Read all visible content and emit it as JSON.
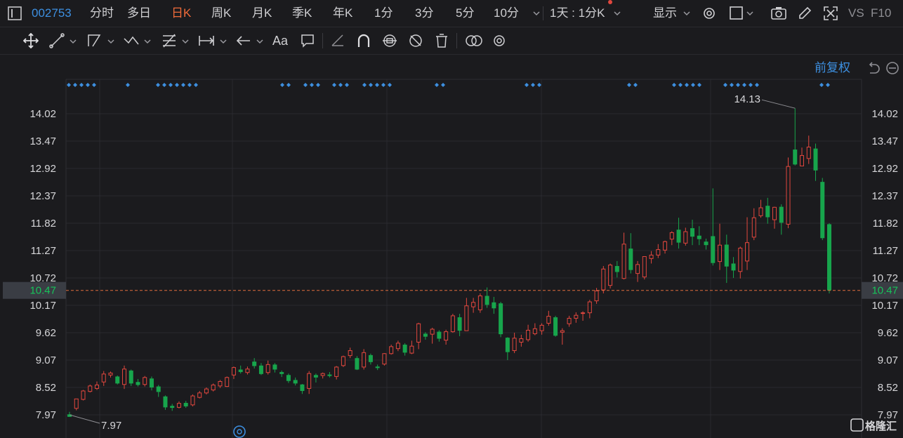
{
  "header": {
    "panel_icon": "panel-icon",
    "stock_code": "002753",
    "periods": [
      "分时",
      "多日",
      "日K",
      "周K",
      "月K",
      "季K",
      "年K",
      "1分",
      "3分",
      "5分",
      "10分"
    ],
    "active_period": "日K",
    "interval_select": "1天 : 1分K",
    "display_label": "显示",
    "vs_label": "VS",
    "f10_label": "F10"
  },
  "drawing_tools": [
    "move-tool",
    "line-tool",
    "polyline-tool",
    "wave-tool",
    "fib-tool",
    "range-tool",
    "arrow-tool",
    "text-tool",
    "note-tool",
    "eraser-tool",
    "magnet-tool",
    "sync-tool",
    "hide-tool",
    "delete-tool",
    "compare-tool",
    "settings-tool"
  ],
  "text_tool_label": "Aa",
  "chart_options": {
    "adjust_label": "前复权"
  },
  "colors": {
    "up": "#e2473e",
    "down": "#17a54c",
    "accent": "#3d8fe0",
    "active_tab": "#f06b3a",
    "current_line": "#e06c3c",
    "current_label_bg": "#3a3d44",
    "current_label_text": "#17c35a"
  },
  "chart_data": {
    "type": "candlestick",
    "y_ticks": [
      "14.02",
      "13.47",
      "12.92",
      "12.37",
      "11.82",
      "11.27",
      "10.72",
      "10.17",
      "9.62",
      "9.07",
      "8.52",
      "7.97"
    ],
    "ylim": [
      7.97,
      14.02
    ],
    "current_price": "10.47",
    "max_label": "14.13",
    "min_label": "7.97",
    "watermark": "格隆汇",
    "candles": [
      [
        7.98,
        7.93,
        8.03,
        7.93
      ],
      [
        8.1,
        8.29,
        8.29,
        8.06
      ],
      [
        8.28,
        8.45,
        8.47,
        8.26
      ],
      [
        8.44,
        8.55,
        8.58,
        8.42
      ],
      [
        8.5,
        8.57,
        8.64,
        8.47
      ],
      [
        8.63,
        8.79,
        8.85,
        8.55
      ],
      [
        8.77,
        8.81,
        8.84,
        8.72
      ],
      [
        8.74,
        8.6,
        8.76,
        8.58
      ],
      [
        8.58,
        8.89,
        8.96,
        8.49
      ],
      [
        8.86,
        8.6,
        8.88,
        8.55
      ],
      [
        8.63,
        8.57,
        8.69,
        8.54
      ],
      [
        8.58,
        8.72,
        8.75,
        8.54
      ],
      [
        8.7,
        8.52,
        8.74,
        8.46
      ],
      [
        8.54,
        8.43,
        8.57,
        8.33
      ],
      [
        8.34,
        8.12,
        8.36,
        8.07
      ],
      [
        8.15,
        8.11,
        8.19,
        8.05
      ],
      [
        8.12,
        8.2,
        8.24,
        8.1
      ],
      [
        8.21,
        8.14,
        8.25,
        8.11
      ],
      [
        8.17,
        8.35,
        8.38,
        8.14
      ],
      [
        8.32,
        8.41,
        8.45,
        8.3
      ],
      [
        8.41,
        8.49,
        8.52,
        8.38
      ],
      [
        8.47,
        8.57,
        8.6,
        8.44
      ],
      [
        8.55,
        8.64,
        8.67,
        8.51
      ],
      [
        8.54,
        8.72,
        8.74,
        8.53
      ],
      [
        8.77,
        8.92,
        8.94,
        8.69
      ],
      [
        8.88,
        8.83,
        8.96,
        8.8
      ],
      [
        8.82,
        8.89,
        8.94,
        8.78
      ],
      [
        9.04,
        8.95,
        9.11,
        8.9
      ],
      [
        8.96,
        8.79,
        9.01,
        8.77
      ],
      [
        8.82,
        8.98,
        9.06,
        8.78
      ],
      [
        8.98,
        8.88,
        9.01,
        8.82
      ],
      [
        8.83,
        8.79,
        8.86,
        8.73
      ],
      [
        8.77,
        8.65,
        8.8,
        8.61
      ],
      [
        8.67,
        8.6,
        8.72,
        8.56
      ],
      [
        8.58,
        8.45,
        8.59,
        8.39
      ],
      [
        8.5,
        8.8,
        8.85,
        8.39
      ],
      [
        8.77,
        8.72,
        8.8,
        8.62
      ],
      [
        8.76,
        8.8,
        8.82,
        8.7
      ],
      [
        8.78,
        8.75,
        8.83,
        8.72
      ],
      [
        8.74,
        8.93,
        8.95,
        8.68
      ],
      [
        8.96,
        9.14,
        9.16,
        8.93
      ],
      [
        9.16,
        9.26,
        9.32,
        9.11
      ],
      [
        9.11,
        8.88,
        9.15,
        8.87
      ],
      [
        8.93,
        9.22,
        9.29,
        8.88
      ],
      [
        9.17,
        9.03,
        9.2,
        8.98
      ],
      [
        8.94,
        8.91,
        8.98,
        8.87
      ],
      [
        8.99,
        9.2,
        9.21,
        8.96
      ],
      [
        9.2,
        9.34,
        9.38,
        9.18
      ],
      [
        9.3,
        9.41,
        9.46,
        9.25
      ],
      [
        9.38,
        9.22,
        9.41,
        9.16
      ],
      [
        9.21,
        9.35,
        9.46,
        9.19
      ],
      [
        9.43,
        9.8,
        9.82,
        9.29
      ],
      [
        9.6,
        9.54,
        9.63,
        9.48
      ],
      [
        9.59,
        9.69,
        9.72,
        9.4
      ],
      [
        9.64,
        9.5,
        9.67,
        9.44
      ],
      [
        9.47,
        9.64,
        9.68,
        9.38
      ],
      [
        9.64,
        9.96,
        10.0,
        9.62
      ],
      [
        9.93,
        9.66,
        10.0,
        9.55
      ],
      [
        9.66,
        10.16,
        10.32,
        9.66
      ],
      [
        10.14,
        10.23,
        10.32,
        10.02
      ],
      [
        10.08,
        10.36,
        10.41,
        10.02
      ],
      [
        10.36,
        10.18,
        10.53,
        10.12
      ],
      [
        10.23,
        10.11,
        10.34,
        10.0
      ],
      [
        10.21,
        9.59,
        10.24,
        9.53
      ],
      [
        9.52,
        9.23,
        9.53,
        9.07
      ],
      [
        9.26,
        9.51,
        9.62,
        9.21
      ],
      [
        9.43,
        9.5,
        9.58,
        9.34
      ],
      [
        9.48,
        9.67,
        9.78,
        9.44
      ],
      [
        9.6,
        9.7,
        9.81,
        9.57
      ],
      [
        9.66,
        9.77,
        9.81,
        9.58
      ],
      [
        9.81,
        9.95,
        10.06,
        9.76
      ],
      [
        9.93,
        9.56,
        9.96,
        9.54
      ],
      [
        9.63,
        9.66,
        9.71,
        9.38
      ],
      [
        9.8,
        9.91,
        9.96,
        9.74
      ],
      [
        9.91,
        9.97,
        10.03,
        9.82
      ],
      [
        10.02,
        10.02,
        10.05,
        9.86
      ],
      [
        10.02,
        10.24,
        10.28,
        9.91
      ],
      [
        10.26,
        10.46,
        10.52,
        10.2
      ],
      [
        10.48,
        10.9,
        10.96,
        10.41
      ],
      [
        10.57,
        10.98,
        11.01,
        10.51
      ],
      [
        10.96,
        10.84,
        11.06,
        10.73
      ],
      [
        10.71,
        11.4,
        11.63,
        10.69
      ],
      [
        11.31,
        10.88,
        11.62,
        10.81
      ],
      [
        10.81,
        10.99,
        11.06,
        10.64
      ],
      [
        10.74,
        11.15,
        11.15,
        10.69
      ],
      [
        11.11,
        11.18,
        11.26,
        11.01
      ],
      [
        11.18,
        11.29,
        11.4,
        11.12
      ],
      [
        11.28,
        11.45,
        11.47,
        11.21
      ],
      [
        11.5,
        11.63,
        11.66,
        11.38
      ],
      [
        11.69,
        11.43,
        11.93,
        11.31
      ],
      [
        11.42,
        11.65,
        11.73,
        11.37
      ],
      [
        11.72,
        11.55,
        11.89,
        11.38
      ],
      [
        11.57,
        11.5,
        11.76,
        11.38
      ],
      [
        11.45,
        11.38,
        11.51,
        11.29
      ],
      [
        11.56,
        11.02,
        12.52,
        10.97
      ],
      [
        11.05,
        11.38,
        11.81,
        10.88
      ],
      [
        11.39,
        10.95,
        11.59,
        10.62
      ],
      [
        11.01,
        10.87,
        11.14,
        10.72
      ],
      [
        10.85,
        11.32,
        11.35,
        10.71
      ],
      [
        11.06,
        11.43,
        11.94,
        10.88
      ],
      [
        11.54,
        11.93,
        12.12,
        11.48
      ],
      [
        11.97,
        12.13,
        12.29,
        11.93
      ],
      [
        12.17,
        11.94,
        12.33,
        11.81
      ],
      [
        11.89,
        12.14,
        12.15,
        11.71
      ],
      [
        12.15,
        11.83,
        12.2,
        11.59
      ],
      [
        11.8,
        12.96,
        13.14,
        11.72
      ],
      [
        13.3,
        13.0,
        14.13,
        12.98
      ],
      [
        12.97,
        13.18,
        13.34,
        13.03
      ],
      [
        13.12,
        13.35,
        13.58,
        13.01
      ],
      [
        13.32,
        12.88,
        13.42,
        12.67
      ],
      [
        12.65,
        11.52,
        12.73,
        11.48
      ],
      [
        11.8,
        10.47,
        11.82,
        10.41
      ]
    ]
  }
}
